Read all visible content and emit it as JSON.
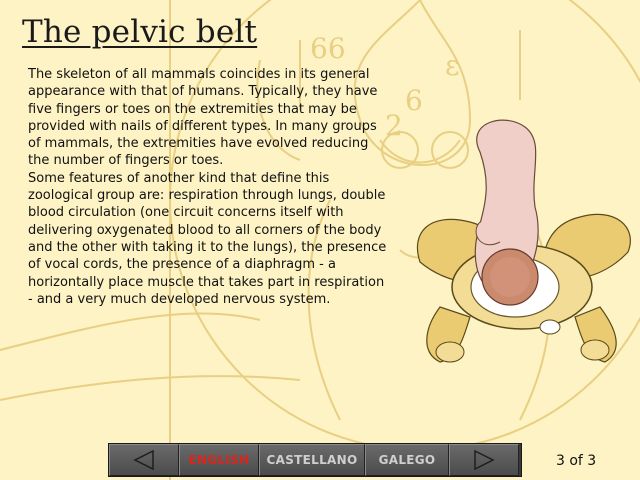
{
  "page": {
    "title": "The pelvic belt",
    "paragraphs": [
      "The skeleton of all mammals coincides in its general appearance with that of humans. Typically, they have five fingers or toes on the extremities that may be provided with nails of different types. In many groups of mammals, the extremities have evolved reducing the number of fingers or toes.",
      "Some features of another kind that define this zoological group are: respiration through lungs, double blood circulation (one circuit concerns itself with delivering oxygenated blood to all corners of the body and the other with taking it to the lungs), the presence of vocal cords, the presence of a diaphragm - a horizontally place muscle that takes part in respiration - and a very much developed nervous system."
    ]
  },
  "nav": {
    "prev_icon": "triangle-left-icon",
    "next_icon": "triangle-right-icon",
    "languages": [
      "ENGLISH",
      "CASTELLANO",
      "GALEGO"
    ],
    "active_language": "ENGLISH"
  },
  "pagination": {
    "label": "3 of 3"
  },
  "colors": {
    "background": "#fdf3c4",
    "sketch_lines": "#e8cf82",
    "active_language": "#d8261c",
    "button_text": "#cfcfcf",
    "nav_bar": "#3a3a3a"
  }
}
